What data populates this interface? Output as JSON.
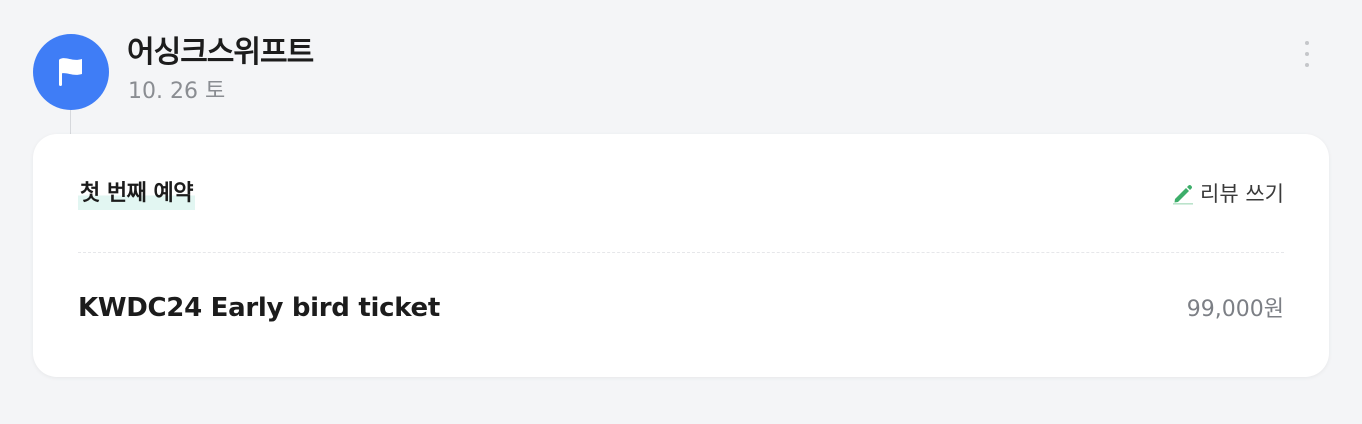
{
  "store": {
    "name": "어싱크스위프트",
    "date": "10. 26 토",
    "avatar_icon": "flag-icon",
    "avatar_color": "#3f7df6"
  },
  "menu": {
    "icon": "more-vertical-icon"
  },
  "reservation": {
    "badge": "첫 번째 예약",
    "review_label": "리뷰 쓰기",
    "review_icon": "pencil-icon",
    "review_icon_color": "#3dae6a",
    "item_name": "KWDC24 Early bird ticket",
    "price": "99,000원"
  }
}
